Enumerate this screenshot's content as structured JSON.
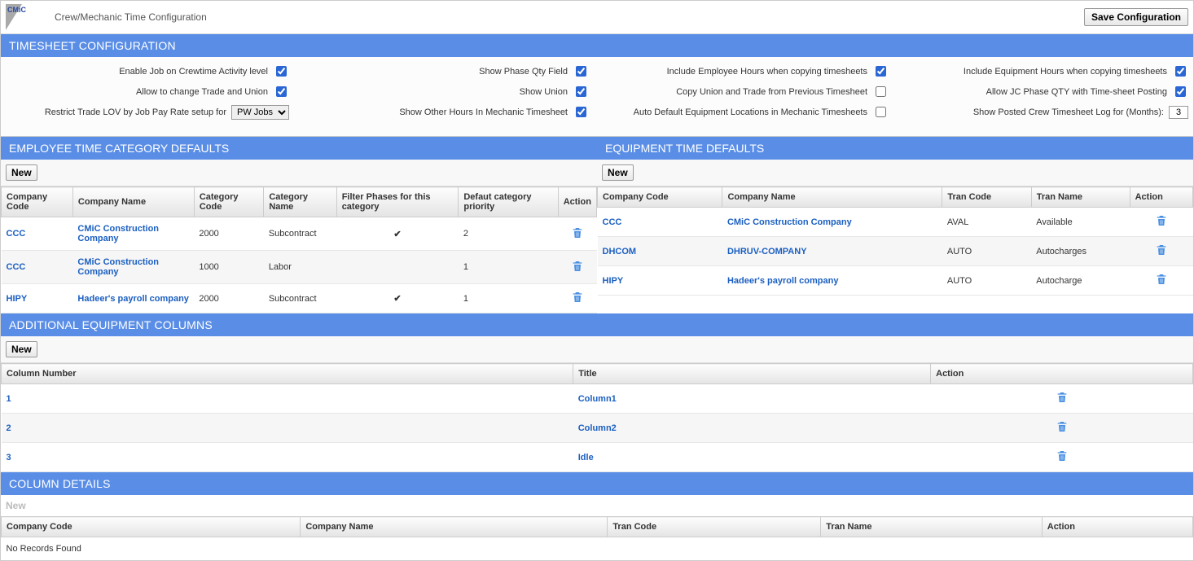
{
  "header": {
    "brand": "CMiC",
    "title": "Crew/Mechanic Time Configuration",
    "save_button": "Save Configuration"
  },
  "sections": {
    "timesheet_config": "TIMESHEET CONFIGURATION",
    "employee_defaults": "EMPLOYEE TIME CATEGORY DEFAULTS",
    "equipment_defaults": "EQUIPMENT TIME DEFAULTS",
    "additional_equipment": "ADDITIONAL EQUIPMENT COLUMNS",
    "column_details": "COLUMN DETAILS"
  },
  "buttons": {
    "new": "New"
  },
  "config": {
    "enable_job_activity": {
      "label": "Enable Job on Crewtime Activity level",
      "checked": true
    },
    "show_phase_qty": {
      "label": "Show Phase Qty Field",
      "checked": true
    },
    "include_emp_hours": {
      "label": "Include Employee Hours when copying timesheets",
      "checked": true
    },
    "include_eq_hours": {
      "label": "Include Equipment Hours when copying timesheets",
      "checked": true
    },
    "allow_change_trade": {
      "label": "Allow to change Trade and Union",
      "checked": true
    },
    "show_union": {
      "label": "Show Union",
      "checked": true
    },
    "copy_union_trade": {
      "label": "Copy Union and Trade from Previous Timesheet",
      "checked": false
    },
    "allow_jc_phase": {
      "label": "Allow JC Phase QTY with Time-sheet Posting",
      "checked": true
    },
    "restrict_trade_lov": {
      "label": "Restrict Trade LOV by Job Pay Rate setup for",
      "value": "PW Jobs",
      "options": [
        "PW Jobs"
      ]
    },
    "show_other_hours": {
      "label": "Show Other Hours In Mechanic Timesheet",
      "checked": true
    },
    "auto_default_eq_loc": {
      "label": "Auto Default Equipment Locations in Mechanic Timesheets",
      "checked": false
    },
    "show_posted_log": {
      "label": "Show Posted Crew Timesheet Log for (Months):",
      "value": "3"
    }
  },
  "employee_table": {
    "headers": [
      "Company Code",
      "Company Name",
      "Category Code",
      "Category Name",
      "Filter Phases for this category",
      "Defaut category priority",
      "Action"
    ],
    "rows": [
      {
        "code": "CCC",
        "name": "CMiC Construction Company",
        "catCode": "2000",
        "catName": "Subcontract",
        "filter": true,
        "priority": "2"
      },
      {
        "code": "CCC",
        "name": "CMiC Construction Company",
        "catCode": "1000",
        "catName": "Labor",
        "filter": false,
        "priority": "1"
      },
      {
        "code": "HIPY",
        "name": "Hadeer's payroll company",
        "catCode": "2000",
        "catName": "Subcontract",
        "filter": true,
        "priority": "1"
      }
    ]
  },
  "equipment_table": {
    "headers": [
      "Company Code",
      "Company Name",
      "Tran Code",
      "Tran Name",
      "Action"
    ],
    "rows": [
      {
        "code": "CCC",
        "name": "CMiC Construction Company",
        "tranCode": "AVAL",
        "tranName": "Available"
      },
      {
        "code": "DHCOM",
        "name": "DHRUV-COMPANY",
        "tranCode": "AUTO",
        "tranName": "Autocharges"
      },
      {
        "code": "HIPY",
        "name": "Hadeer's payroll company",
        "tranCode": "AUTO",
        "tranName": "Autocharge"
      }
    ]
  },
  "additional_columns": {
    "headers": [
      "Column Number",
      "Title",
      "Action"
    ],
    "rows": [
      {
        "num": "1",
        "title": "Column1"
      },
      {
        "num": "2",
        "title": "Column2"
      },
      {
        "num": "3",
        "title": "Idle"
      }
    ]
  },
  "column_details": {
    "headers": [
      "Company Code",
      "Company Name",
      "Tran Code",
      "Tran Name",
      "Action"
    ],
    "empty": "No Records Found"
  }
}
